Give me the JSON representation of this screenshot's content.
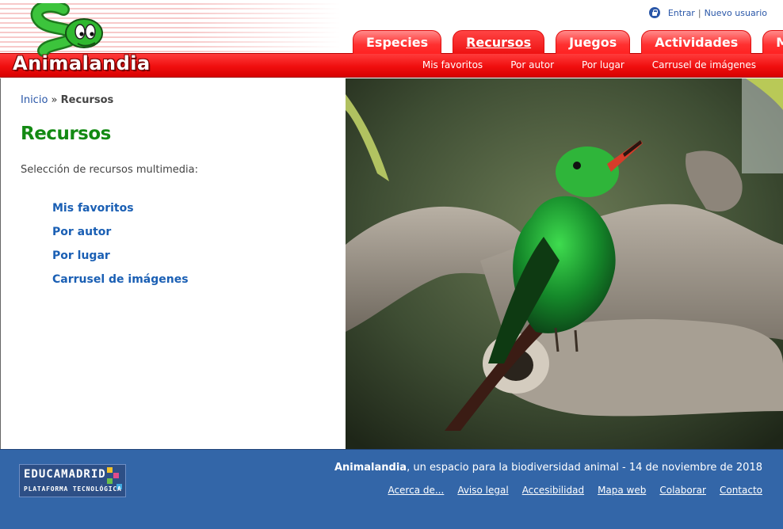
{
  "site": {
    "logo_text": "Animalandia"
  },
  "userlinks": {
    "login": "Entrar",
    "separator": "|",
    "register": "Nuevo usuario"
  },
  "tabs": [
    {
      "label": "Especies",
      "active": false
    },
    {
      "label": "Recursos",
      "active": true
    },
    {
      "label": "Juegos",
      "active": false
    },
    {
      "label": "Actividades",
      "active": false
    },
    {
      "label": "Más...",
      "active": false
    }
  ],
  "subnav": [
    "Mis favoritos",
    "Por autor",
    "Por lugar",
    "Carrusel de imágenes"
  ],
  "breadcrumb": {
    "home": "Inicio",
    "separator": "»",
    "current": "Recursos"
  },
  "page": {
    "title": "Recursos",
    "intro": "Selección de recursos multimedia:",
    "resources": [
      "Mis favoritos",
      "Por autor",
      "Por lugar",
      "Carrusel de imágenes"
    ]
  },
  "footer": {
    "edu_logo_title": "EDUCAMADRID",
    "edu_logo_sub": "PLATAFORMA TECNOLÓGICA",
    "site_name": "Animalandia",
    "tagline": ", un espacio para la biodiversidad animal - 14 de noviembre de 2018",
    "links": [
      "Acerca de...",
      "Aviso legal",
      "Accesibilidad",
      "Mapa web",
      "Colaborar",
      "Contacto"
    ]
  },
  "colors": {
    "brand_red": "#f00f0f",
    "brand_green": "#138a13",
    "link_blue": "#2a57a8",
    "footer_blue": "#3366a8"
  },
  "icons": {
    "login": "lock-icon",
    "logo": "snake-icon"
  }
}
